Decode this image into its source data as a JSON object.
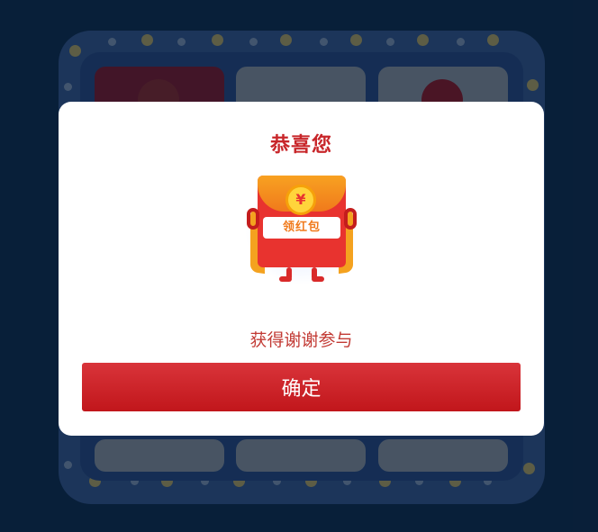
{
  "modal": {
    "title": "恭喜您",
    "envelope_coin_symbol": "¥",
    "envelope_label": "领红包",
    "result_text": "获得谢谢参与",
    "confirm_label": "确定"
  },
  "colors": {
    "page_background": "#0e2f51",
    "accent_red": "#c8262a",
    "button_red": "#c1161b",
    "envelope_orange": "#f4a21f"
  }
}
